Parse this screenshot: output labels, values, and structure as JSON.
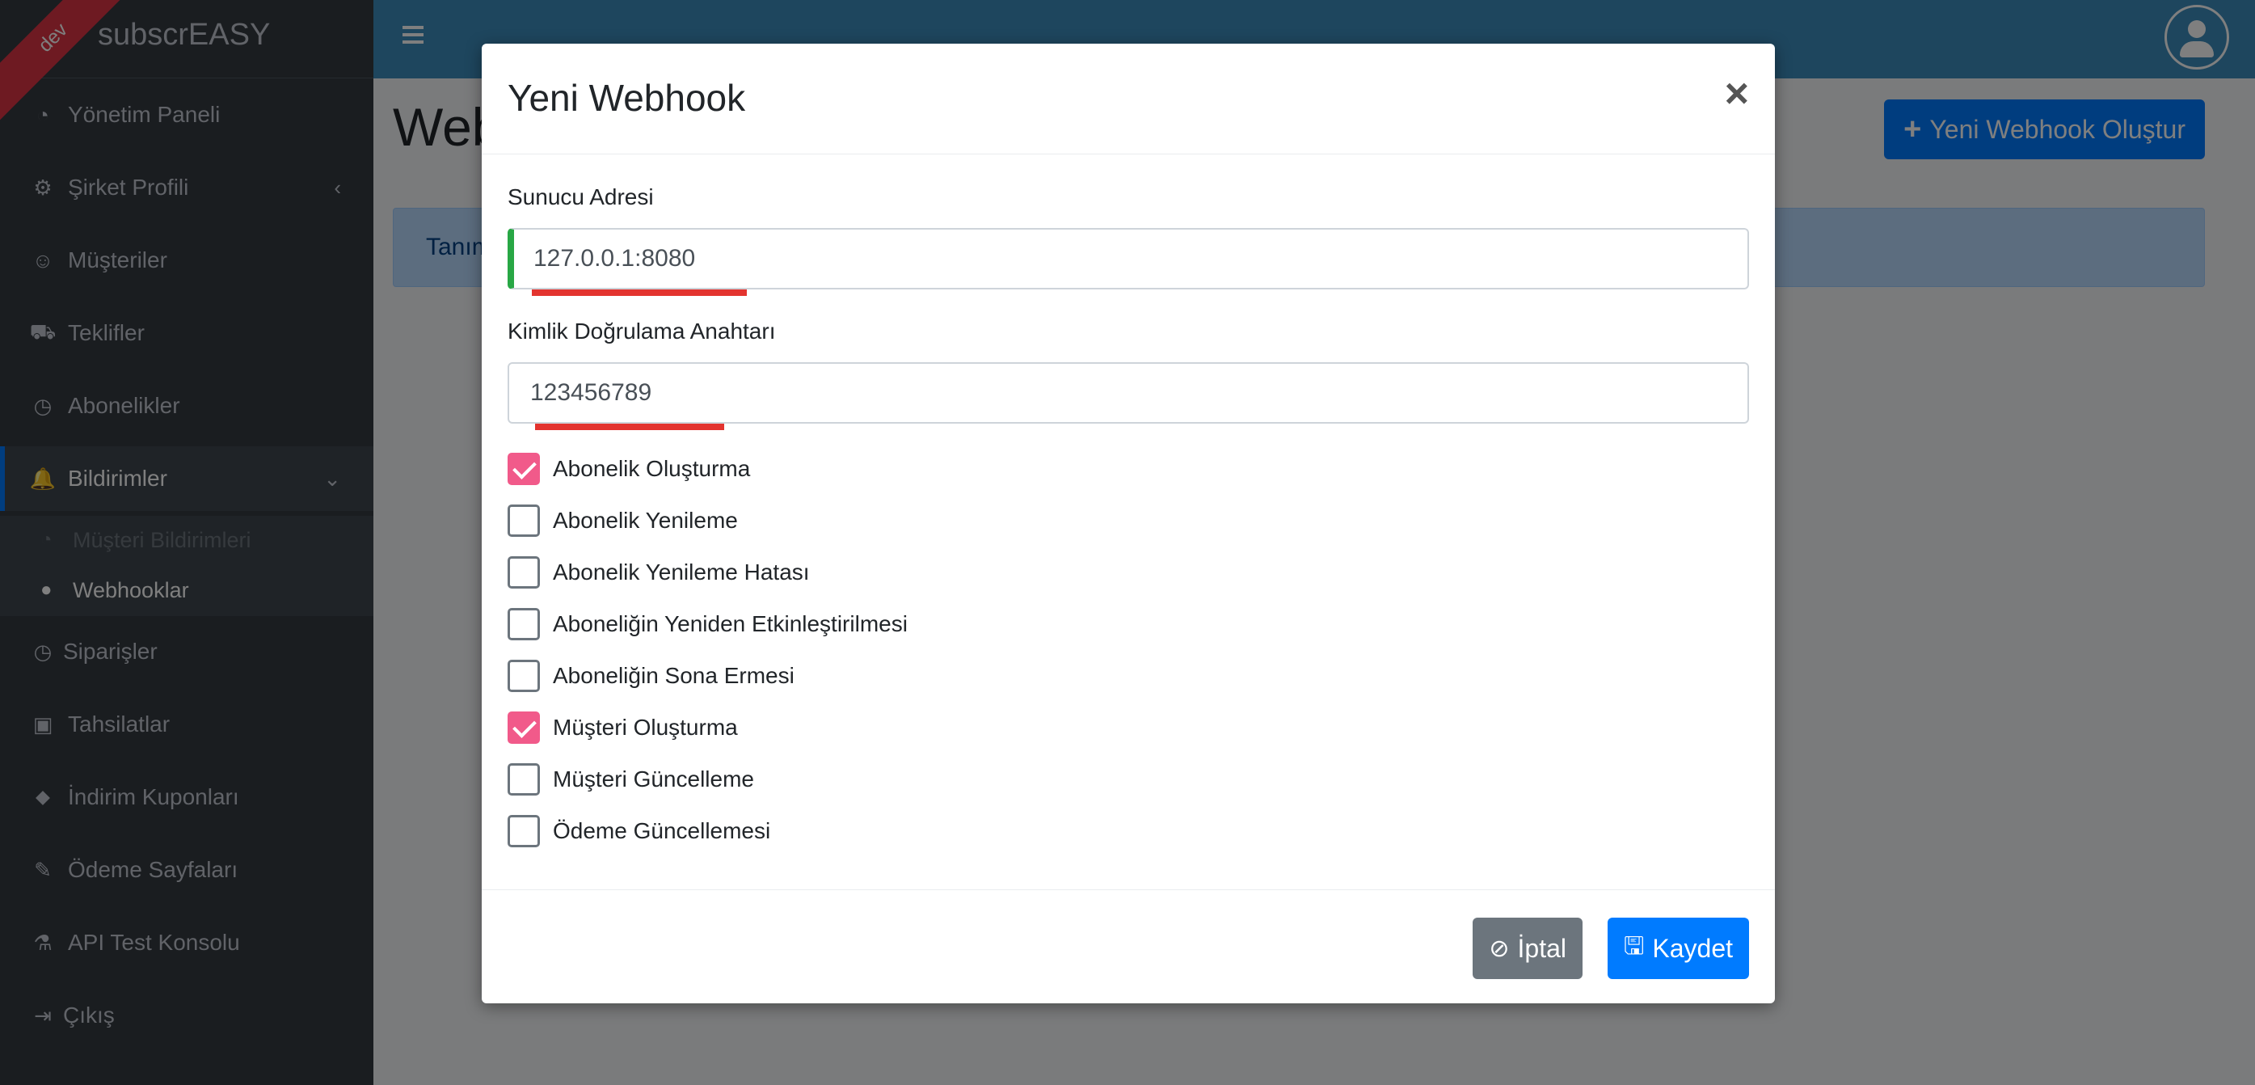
{
  "brand": {
    "name": "subscrEASY",
    "ribbon": "dev"
  },
  "sidebar": {
    "items": [
      {
        "label": "Yönetim Paneli",
        "icon": "dashboard-icon",
        "glyph": "◔"
      },
      {
        "label": "Şirket Profili",
        "icon": "gear-icon",
        "glyph": "⚙",
        "chevron": "‹"
      },
      {
        "label": "Müşteriler",
        "icon": "smile-icon",
        "glyph": "☺"
      },
      {
        "label": "Teklifler",
        "icon": "cart-icon",
        "glyph": "⛟"
      },
      {
        "label": "Abonelikler",
        "icon": "clock-icon",
        "glyph": "◷"
      },
      {
        "label": "Bildirimler",
        "icon": "bell-icon",
        "glyph": "🔔",
        "chevron": "⌄"
      },
      {
        "label": "Siparişler",
        "icon": "clock-icon",
        "glyph": "◷"
      },
      {
        "label": "Tahsilatlar",
        "icon": "money-icon",
        "glyph": "▣"
      },
      {
        "label": "İndirim Kuponları",
        "icon": "tag-icon",
        "glyph": "⬥"
      },
      {
        "label": "Ödeme Sayfaları",
        "icon": "wand-icon",
        "glyph": "✎"
      },
      {
        "label": "API Test Konsolu",
        "icon": "flask-icon",
        "glyph": "⚗"
      },
      {
        "label": "Çıkış",
        "icon": "logout-icon",
        "glyph": "⇥"
      }
    ],
    "subitems": [
      {
        "label": "Müşteri Bildirimleri",
        "icon": "dashboard-icon",
        "glyph": "◔"
      },
      {
        "label": "Webhooklar",
        "icon": "user-icon",
        "glyph": "●"
      }
    ]
  },
  "content": {
    "title": "Webhooklar",
    "create_button": "Yeni Webhook Oluştur",
    "info_text": "Tanımlı webhook bulunmamaktadır."
  },
  "modal": {
    "title": "Yeni Webhook",
    "close": "×",
    "server_label": "Sunucu Adresi",
    "server_value": "127.0.0.1:8080",
    "key_label": "Kimlik Doğrulama Anahtarı",
    "key_value": "123456789",
    "events": [
      {
        "label": "Abonelik Oluşturma",
        "checked": true
      },
      {
        "label": "Abonelik Yenileme",
        "checked": false
      },
      {
        "label": "Abonelik Yenileme Hatası",
        "checked": false
      },
      {
        "label": "Aboneliğin Yeniden Etkinleştirilmesi",
        "checked": false
      },
      {
        "label": "Aboneliğin Sona Ermesi",
        "checked": false
      },
      {
        "label": "Müşteri Oluşturma",
        "checked": true
      },
      {
        "label": "Müşteri Güncelleme",
        "checked": false
      },
      {
        "label": "Ödeme Güncellemesi",
        "checked": false
      }
    ],
    "cancel_label": "İptal",
    "save_label": "Kaydet"
  },
  "colors": {
    "accent": "#007bff",
    "check": "#f15a8a",
    "valid": "#28a745",
    "sidebar": "#343a40"
  }
}
